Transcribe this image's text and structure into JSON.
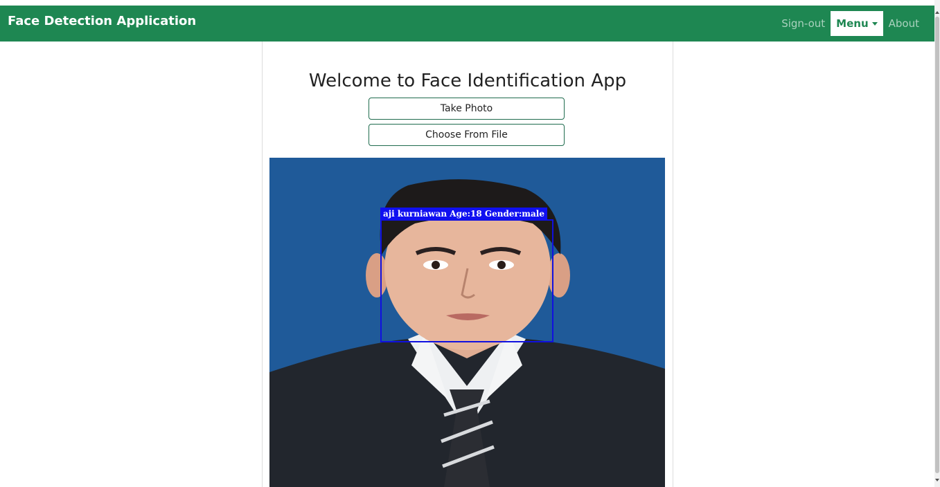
{
  "navbar": {
    "brand": "Face Detection Application",
    "links": {
      "sign_out": "Sign-out",
      "menu": "Menu",
      "about": "About"
    },
    "color": "#1e8752"
  },
  "main": {
    "title": "Welcome to Face Identification App",
    "buttons": {
      "take_photo": "Take Photo",
      "choose_file": "Choose From File"
    },
    "detection": {
      "label": "aji kurniawan Age:18 Gender:male",
      "box_color": "#1010e0"
    }
  }
}
